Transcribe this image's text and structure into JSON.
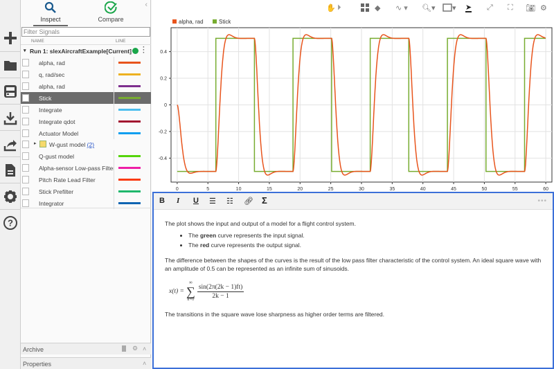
{
  "left_toolbar": {
    "icons": [
      "new-icon",
      "open-folder-icon",
      "save-icon",
      "import-icon",
      "export-icon",
      "report-icon",
      "settings-icon",
      "help-icon"
    ]
  },
  "side_panel": {
    "tabs": [
      {
        "label": "Inspect",
        "active": true
      },
      {
        "label": "Compare",
        "active": false
      }
    ],
    "filter_placeholder": "Filter Signals",
    "columns": {
      "name": "NAME",
      "line": "LINE"
    },
    "run": {
      "label": "Run 1: slexAircraftExample[Current]",
      "status_color": "#1aa64a"
    },
    "signals": [
      {
        "name": "alpha, rad",
        "color": "#e8541c",
        "selected": false
      },
      {
        "name": "q, rad/sec",
        "color": "#edb120",
        "selected": false
      },
      {
        "name": "alpha, rad",
        "color": "#7e2f8e",
        "selected": false
      },
      {
        "name": "Stick",
        "color": "#77ac30",
        "selected": true
      },
      {
        "name": "Integrate",
        "color": "#4dbeee",
        "selected": false
      },
      {
        "name": "Integrate qdot",
        "color": "#a2142f",
        "selected": false
      },
      {
        "name": "Actuator Model",
        "color": "#0d9ef0",
        "selected": false
      }
    ],
    "group": {
      "name": "W-gust model",
      "count": "(2)"
    },
    "signals2": [
      {
        "name": "Q-gust model",
        "color": "#55d40b"
      },
      {
        "name": "Alpha-sensor Low-pass Filter",
        "color": "#ee1ea6"
      },
      {
        "name": "Pitch Rate Lead Filter",
        "color": "#fa3a12"
      },
      {
        "name": "Stick Prefilter",
        "color": "#1fb76c"
      },
      {
        "name": "Integrator",
        "color": "#0f65b2"
      }
    ],
    "archive_label": "Archive",
    "properties_label": "Properties"
  },
  "plot_toolbar": [
    "pan-icon",
    "play-icon",
    "layout-icon",
    "clear-icon",
    "cursor-wave-icon",
    "zoom-icon",
    "fit-icon",
    "select-cursor-icon",
    "expand-icon",
    "fullscreen-icon",
    "camera-icon",
    "gear-icon"
  ],
  "chart_data": {
    "type": "line",
    "title": "",
    "xlabel": "",
    "ylabel": "",
    "xlim": [
      -1,
      61
    ],
    "ylim": [
      -0.58,
      0.58
    ],
    "xticks": [
      0,
      5,
      10,
      15,
      20,
      25,
      30,
      35,
      40,
      45,
      50,
      55,
      60
    ],
    "yticks": [
      -0.4,
      -0.2,
      0,
      0.2,
      0.4
    ],
    "grid": true,
    "legend": {
      "placement": "top-left",
      "entries": [
        {
          "name": "alpha, rad",
          "color": "#e8541c"
        },
        {
          "name": "Stick",
          "color": "#77ac30"
        }
      ]
    },
    "series": [
      {
        "name": "Stick",
        "color": "#77ac30",
        "kind": "square",
        "amplitude": 0.5,
        "period": 12.566,
        "start_value": -0.5,
        "t_end": 60
      },
      {
        "name": "alpha, rad",
        "color": "#e8541c",
        "kind": "filtered-square",
        "amplitude": 0.5,
        "overshoot": 0.03,
        "initial": 0,
        "t_end": 60
      }
    ]
  },
  "editor": {
    "toolbar": [
      "B",
      "I",
      "U",
      "bullet-list",
      "numbered-list",
      "link",
      "sigma"
    ],
    "para1": "The plot shows the input and output of a model for a flight control system.",
    "bullet1": {
      "pre": "The ",
      "bold": "green",
      "post": " curve represents the input signal."
    },
    "bullet2": {
      "pre": "The ",
      "bold": "red",
      "post": " curve represents the output signal."
    },
    "para2": "The difference between the shapes of the curves is the result of the low pass filter characteristic of the control system. An ideal square wave with an amplitude of 0.5 can be represented as an infinite sum of sinusoids.",
    "formula": {
      "lhs": "x(t) =",
      "upper": "∞",
      "lower": "k=0",
      "num": "sin(2π(2k − 1)ft)",
      "den": "2k − 1"
    },
    "para3": "The transitions in the square wave lose sharpness as higher order terms are filtered."
  }
}
